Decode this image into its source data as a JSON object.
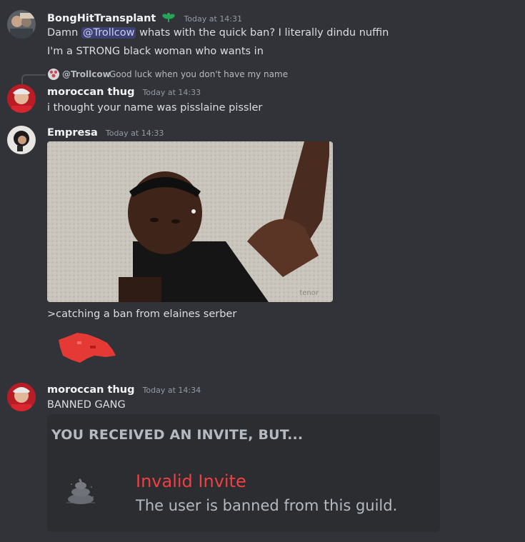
{
  "messages": [
    {
      "username": "BongHitTransplant",
      "timestamp": "Today at 14:31",
      "lines": [
        {
          "before": "Damn ",
          "mention": "@Trollcow",
          "after": " whats with the quick ban? I literally dindu nuffin"
        },
        {
          "text": "I'm a STRONG black woman who wants in"
        }
      ]
    },
    {
      "reply": {
        "username": "@Trollcow",
        "text": "Good luck when you don't have my name"
      },
      "username": "moroccan thug",
      "timestamp": "Today at 14:33",
      "text": "i thought your name was pisslaine pissler"
    },
    {
      "username": "Empresa",
      "timestamp": "Today at 14:33",
      "text": ">catching a ban from elaines serber",
      "gif_watermark": "tenor"
    },
    {
      "username": "moroccan thug",
      "timestamp": "Today at 14:34",
      "text": "BANNED GANG",
      "invite": {
        "header": "YOU RECEIVED AN INVITE, BUT...",
        "title": "Invalid Invite",
        "description": "The user is banned from this guild.",
        "icon": "poop-icon"
      }
    }
  ],
  "colors": {
    "background": "#313338",
    "embed_background": "#2b2d31",
    "mention_background": "#3c4270",
    "invalid_red": "#f23f43",
    "badge_green": "#23a55a"
  }
}
